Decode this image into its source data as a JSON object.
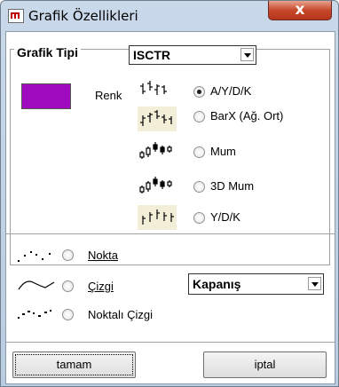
{
  "window": {
    "title": "Grafik Özellikleri",
    "close_label": "x"
  },
  "group": {
    "title": "Grafik Tipi",
    "symbol": "ISCTR",
    "color_label": "Renk",
    "color_value": "#a10bbf"
  },
  "chart_types": [
    {
      "label": "A/Y/D/K",
      "selected": true,
      "icon": "ohlc-bars-icon"
    },
    {
      "label": "BarX  (Ağ. Ort)",
      "selected": false,
      "icon": "barx-icon"
    },
    {
      "label": "Mum",
      "selected": false,
      "icon": "candlestick-icon"
    },
    {
      "label": "3D Mum",
      "selected": false,
      "icon": "candlestick-3d-icon"
    },
    {
      "label": "Y/D/K",
      "selected": false,
      "icon": "hlc-bars-icon"
    }
  ],
  "line_types": [
    {
      "label": "Nokta",
      "icon": "dots-icon"
    },
    {
      "label": "Çizgi",
      "icon": "line-icon"
    },
    {
      "label": "Noktalı Çizgi",
      "icon": "dotted-line-icon"
    }
  ],
  "price_field": {
    "value": "Kapanış"
  },
  "buttons": {
    "ok": "tamam",
    "cancel": "iptal"
  }
}
